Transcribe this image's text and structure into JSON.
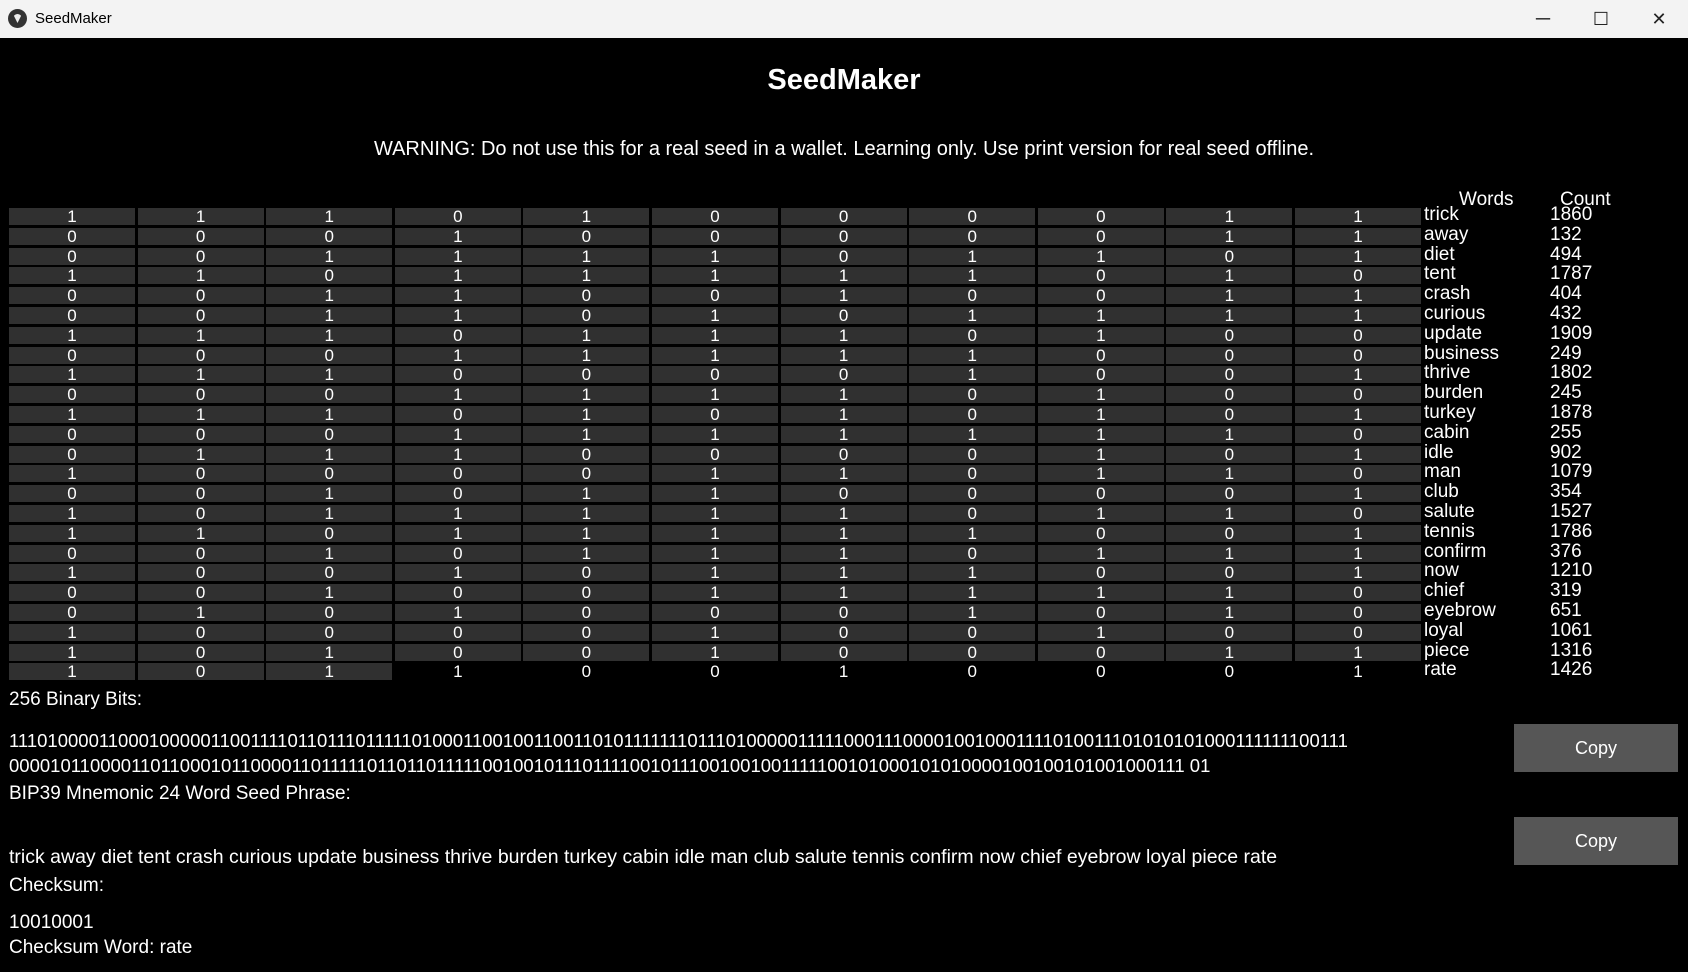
{
  "window": {
    "title": "SeedMaker",
    "minimize": "─",
    "maximize": "☐",
    "close": "✕"
  },
  "heading": "SeedMaker",
  "warning": "WARNING: Do not use this for a real seed in a wallet. Learning only. Use print version for real seed offline.",
  "table": {
    "words_header": "Words",
    "count_header": "Count",
    "rows": [
      {
        "bits": [
          "1",
          "1",
          "1",
          "0",
          "1",
          "0",
          "0",
          "0",
          "0",
          "1",
          "1"
        ],
        "word": "trick",
        "count": "1860"
      },
      {
        "bits": [
          "0",
          "0",
          "0",
          "1",
          "0",
          "0",
          "0",
          "0",
          "0",
          "1",
          "1"
        ],
        "word": "away",
        "count": "132"
      },
      {
        "bits": [
          "0",
          "0",
          "1",
          "1",
          "1",
          "1",
          "0",
          "1",
          "1",
          "0",
          "1"
        ],
        "word": "diet",
        "count": "494"
      },
      {
        "bits": [
          "1",
          "1",
          "0",
          "1",
          "1",
          "1",
          "1",
          "1",
          "0",
          "1",
          "0"
        ],
        "word": "tent",
        "count": "1787"
      },
      {
        "bits": [
          "0",
          "0",
          "1",
          "1",
          "0",
          "0",
          "1",
          "0",
          "0",
          "1",
          "1"
        ],
        "word": "crash",
        "count": "404"
      },
      {
        "bits": [
          "0",
          "0",
          "1",
          "1",
          "0",
          "1",
          "0",
          "1",
          "1",
          "1",
          "1"
        ],
        "word": "curious",
        "count": "432"
      },
      {
        "bits": [
          "1",
          "1",
          "1",
          "0",
          "1",
          "1",
          "1",
          "0",
          "1",
          "0",
          "0"
        ],
        "word": "update",
        "count": "1909"
      },
      {
        "bits": [
          "0",
          "0",
          "0",
          "1",
          "1",
          "1",
          "1",
          "1",
          "0",
          "0",
          "0"
        ],
        "word": "business",
        "count": "249"
      },
      {
        "bits": [
          "1",
          "1",
          "1",
          "0",
          "0",
          "0",
          "0",
          "1",
          "0",
          "0",
          "1"
        ],
        "word": "thrive",
        "count": "1802"
      },
      {
        "bits": [
          "0",
          "0",
          "0",
          "1",
          "1",
          "1",
          "1",
          "0",
          "1",
          "0",
          "0"
        ],
        "word": "burden",
        "count": "245"
      },
      {
        "bits": [
          "1",
          "1",
          "1",
          "0",
          "1",
          "0",
          "1",
          "0",
          "1",
          "0",
          "1"
        ],
        "word": "turkey",
        "count": "1878"
      },
      {
        "bits": [
          "0",
          "0",
          "0",
          "1",
          "1",
          "1",
          "1",
          "1",
          "1",
          "1",
          "0"
        ],
        "word": "cabin",
        "count": "255"
      },
      {
        "bits": [
          "0",
          "1",
          "1",
          "1",
          "0",
          "0",
          "0",
          "0",
          "1",
          "0",
          "1"
        ],
        "word": "idle",
        "count": "902"
      },
      {
        "bits": [
          "1",
          "0",
          "0",
          "0",
          "0",
          "1",
          "1",
          "0",
          "1",
          "1",
          "0"
        ],
        "word": "man",
        "count": "1079"
      },
      {
        "bits": [
          "0",
          "0",
          "1",
          "0",
          "1",
          "1",
          "0",
          "0",
          "0",
          "0",
          "1"
        ],
        "word": "club",
        "count": "354"
      },
      {
        "bits": [
          "1",
          "0",
          "1",
          "1",
          "1",
          "1",
          "1",
          "0",
          "1",
          "1",
          "0"
        ],
        "word": "salute",
        "count": "1527"
      },
      {
        "bits": [
          "1",
          "1",
          "0",
          "1",
          "1",
          "1",
          "1",
          "1",
          "0",
          "0",
          "1"
        ],
        "word": "tennis",
        "count": "1786"
      },
      {
        "bits": [
          "0",
          "0",
          "1",
          "0",
          "1",
          "1",
          "1",
          "0",
          "1",
          "1",
          "1"
        ],
        "word": "confirm",
        "count": "376"
      },
      {
        "bits": [
          "1",
          "0",
          "0",
          "1",
          "0",
          "1",
          "1",
          "1",
          "0",
          "0",
          "1"
        ],
        "word": "now",
        "count": "1210"
      },
      {
        "bits": [
          "0",
          "0",
          "1",
          "0",
          "0",
          "1",
          "1",
          "1",
          "1",
          "1",
          "0"
        ],
        "word": "chief",
        "count": "319"
      },
      {
        "bits": [
          "0",
          "1",
          "0",
          "1",
          "0",
          "0",
          "0",
          "1",
          "0",
          "1",
          "0"
        ],
        "word": "eyebrow",
        "count": "651"
      },
      {
        "bits": [
          "1",
          "0",
          "0",
          "0",
          "0",
          "1",
          "0",
          "0",
          "1",
          "0",
          "0"
        ],
        "word": "loyal",
        "count": "1061"
      },
      {
        "bits": [
          "1",
          "0",
          "1",
          "0",
          "0",
          "1",
          "0",
          "0",
          "0",
          "1",
          "1"
        ],
        "word": "piece",
        "count": "1316"
      },
      {
        "bits": [
          "1",
          "0",
          "1",
          "1",
          "0",
          "0",
          "1",
          "0",
          "0",
          "0",
          "1"
        ],
        "word": "rate",
        "count": "1426"
      }
    ]
  },
  "bits_label": "256 Binary Bits:",
  "bits_line1": "1110100001100010000011001111011011101111101000110010011001101011111110111010000011111000111000010010001111010011101010101000111111100111",
  "bits_line2": "0000101100001101100010110000110111110110110111110010010111011110010111001001001111100101000101010000100100101001000111 01",
  "copy_label": "Copy",
  "mnemonic_label": "BIP39 Mnemonic 24 Word Seed Phrase:",
  "mnemonic": "trick away diet tent crash curious update business thrive burden turkey cabin idle man club salute tennis confirm now chief eyebrow loyal piece rate",
  "checksum_label": "Checksum:",
  "checksum": "10010001",
  "checksum_word_line": "Checksum Word: rate"
}
